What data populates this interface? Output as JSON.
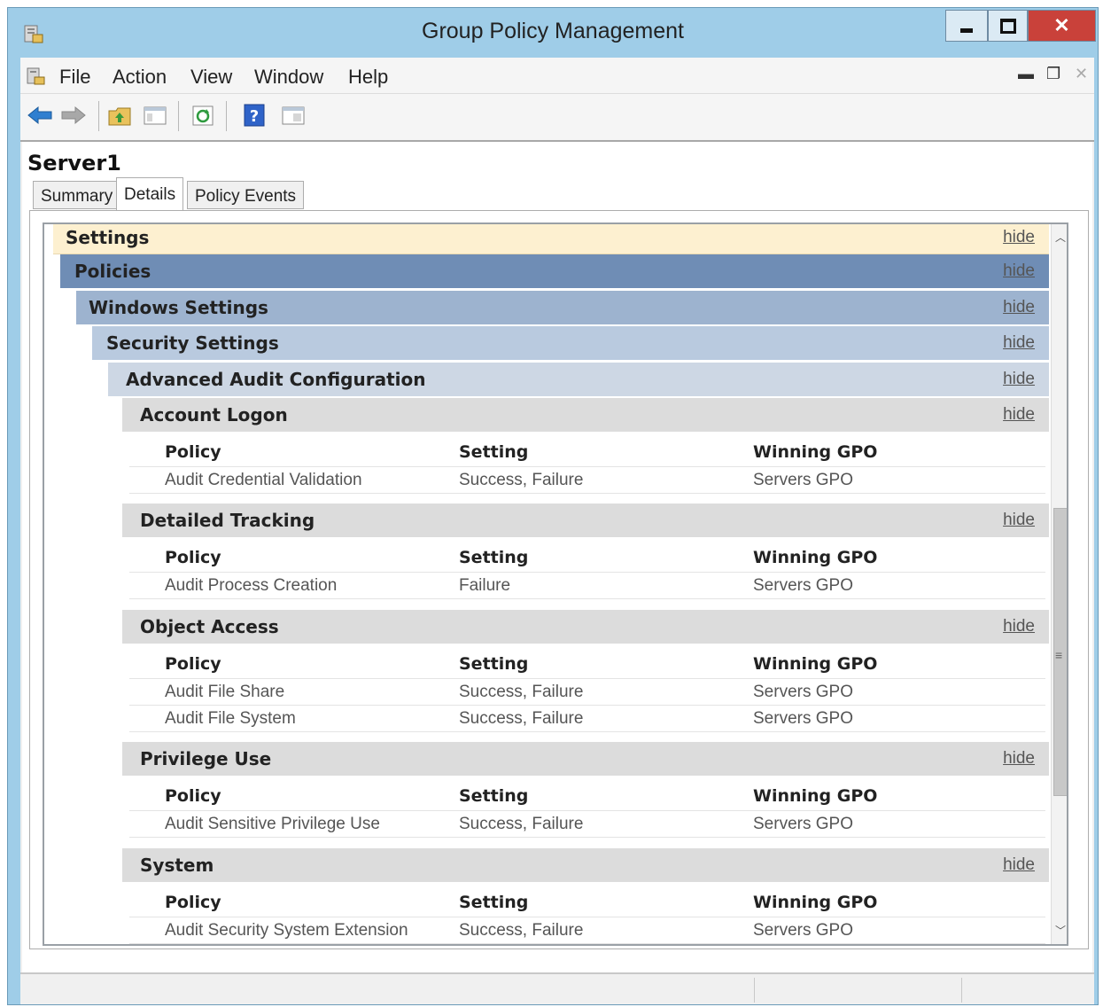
{
  "window": {
    "title": "Group Policy Management",
    "app_icon": "gpmc-icon"
  },
  "menu": {
    "items": [
      {
        "label": "File",
        "key": "F"
      },
      {
        "label": "Action",
        "key": "A"
      },
      {
        "label": "View",
        "key": "V"
      },
      {
        "label": "Window",
        "key": "W"
      },
      {
        "label": "Help",
        "key": "H"
      }
    ]
  },
  "toolbar": {
    "buttons": [
      "back-icon",
      "forward-icon",
      "up-folder-icon",
      "console-tree-icon",
      "refresh-icon",
      "help-icon",
      "properties-icon"
    ]
  },
  "scope": {
    "name": "Server1"
  },
  "tabs": [
    {
      "label": "Summary",
      "active": false
    },
    {
      "label": "Details",
      "active": true
    },
    {
      "label": "Policy Events",
      "active": false
    }
  ],
  "report": {
    "hide_label": "hide",
    "sections": {
      "settings": "Settings",
      "policies": "Policies",
      "windows_settings": "Windows Settings",
      "security_settings": "Security Settings",
      "advanced_audit": "Advanced Audit Configuration"
    },
    "columns": {
      "policy": "Policy",
      "setting": "Setting",
      "winning_gpo": "Winning GPO"
    },
    "categories": [
      {
        "name": "Account Logon",
        "rows": [
          {
            "policy": "Audit Credential Validation",
            "setting": "Success, Failure",
            "gpo": "Servers GPO"
          }
        ]
      },
      {
        "name": "Detailed Tracking",
        "rows": [
          {
            "policy": "Audit Process Creation",
            "setting": "Failure",
            "gpo": "Servers GPO"
          }
        ]
      },
      {
        "name": "Object Access",
        "rows": [
          {
            "policy": "Audit File Share",
            "setting": "Success, Failure",
            "gpo": "Servers GPO"
          },
          {
            "policy": "Audit File System",
            "setting": "Success, Failure",
            "gpo": "Servers GPO"
          }
        ]
      },
      {
        "name": "Privilege Use",
        "rows": [
          {
            "policy": "Audit Sensitive Privilege Use",
            "setting": "Success, Failure",
            "gpo": "Servers GPO"
          }
        ]
      },
      {
        "name": "System",
        "rows": [
          {
            "policy": "Audit Security System Extension",
            "setting": "Success, Failure",
            "gpo": "Servers GPO"
          }
        ]
      }
    ]
  },
  "colors": {
    "settings_bar": "#fdf0d0",
    "policies_bar": "#6f8db5",
    "windows_settings_bar": "#9db3cf",
    "security_settings_bar": "#b9cadf",
    "advanced_audit_bar": "#cdd7e4",
    "category_bar": "#dcdcdc"
  }
}
